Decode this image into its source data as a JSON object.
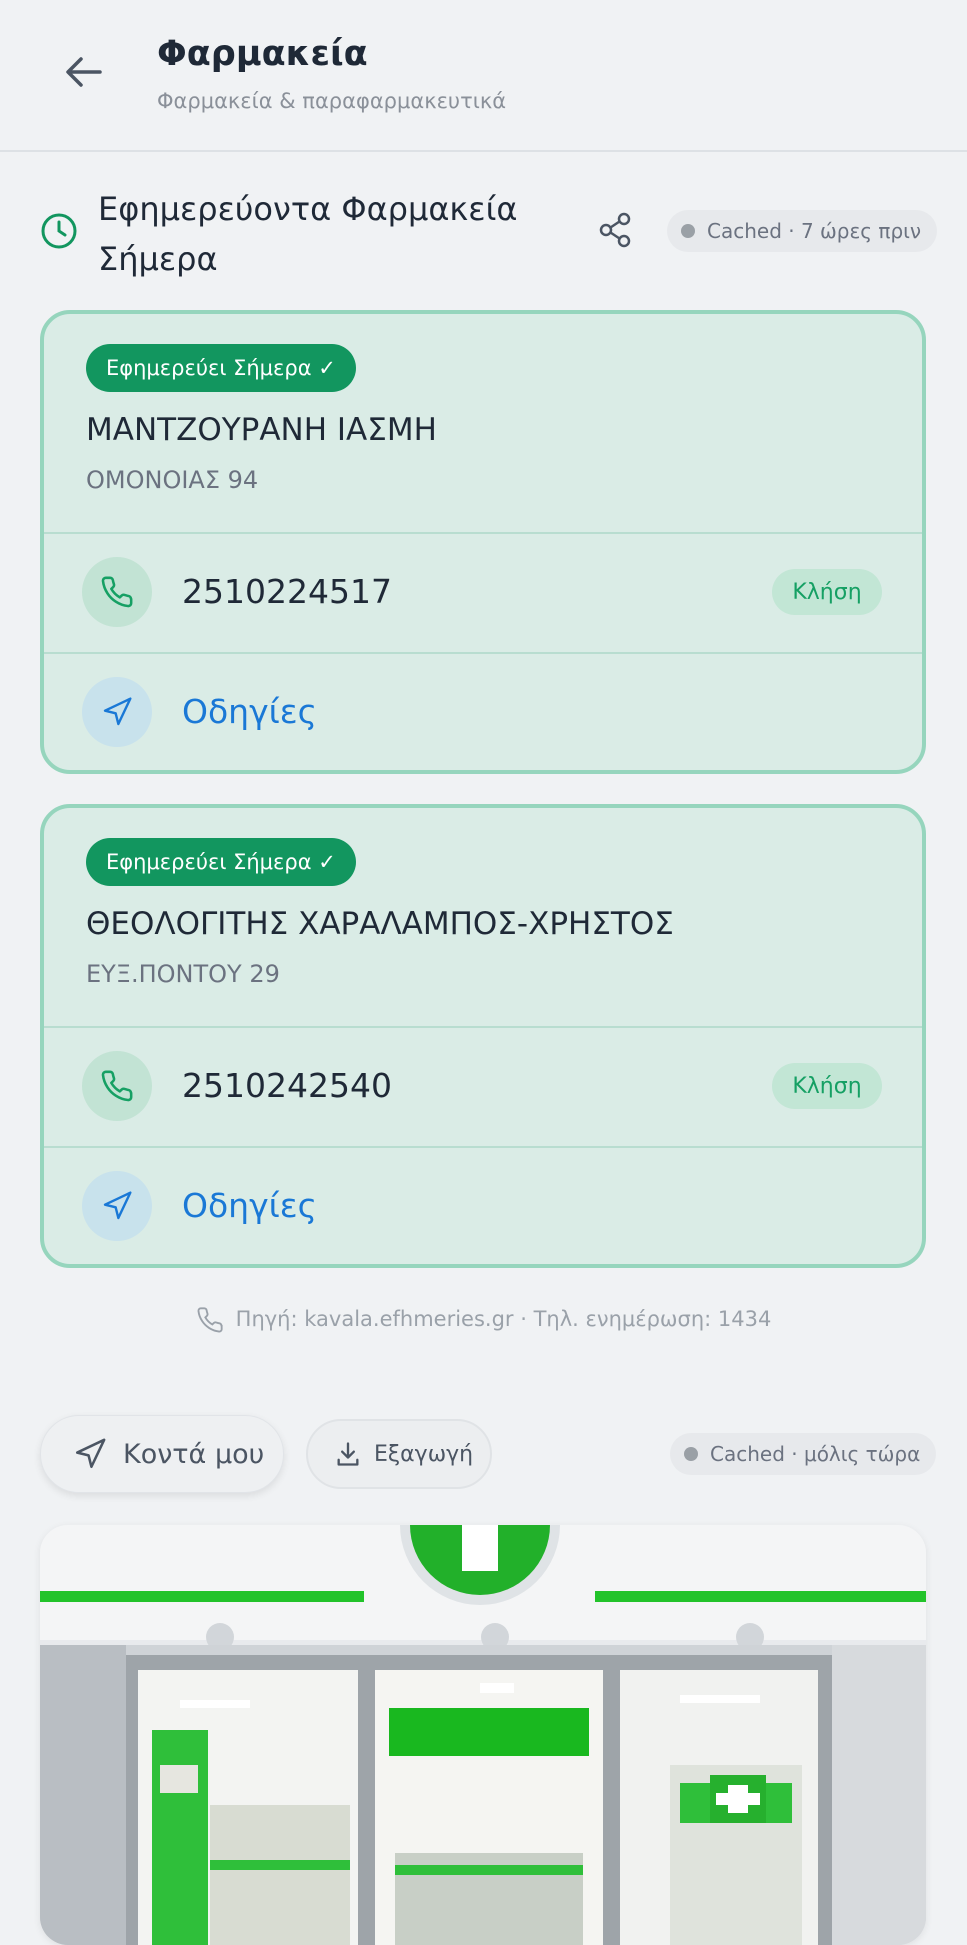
{
  "header": {
    "title": "Φαρμακεία",
    "subtitle": "Φαρμακεία & παραφαρμακευτικά"
  },
  "section": {
    "title": "Εφημερεύοντα Φαρμακεία Σήμερα",
    "cache_status": "Cached · 7 ώρες πριν"
  },
  "pharmacies": [
    {
      "badge": "Εφημερεύει Σήμερα ✓",
      "name": "ΜΑΝΤΖΟΥΡΑΝΗ ΙΑΣΜΗ",
      "address": "ΟΜΟΝΟΙΑΣ 94",
      "phone": "2510224517",
      "call_label": "Κλήση",
      "directions_label": "Οδηγίες"
    },
    {
      "badge": "Εφημερεύει Σήμερα ✓",
      "name": "ΘΕΟΛΟΓΙΤΗΣ ΧΑΡΑΛΑΜΠΟΣ-ΧΡΗΣΤΟΣ",
      "address": "ΕΥΞ.ΠΟΝΤΟΥ 29",
      "phone": "2510242540",
      "call_label": "Κλήση",
      "directions_label": "Οδηγίες"
    }
  ],
  "source_line": "Πηγή: kavala.efhmeries.gr · Τηλ. ενημέρωση: 1434",
  "actions": {
    "near_me": "Κοντά μου",
    "export": "Εξαγωγή",
    "cache_status": "Cached · μόλις τώρα"
  },
  "colors": {
    "accent_green": "#12965f",
    "card_bg": "#daece6",
    "card_border": "#96d5bd",
    "link_blue": "#1a78d6",
    "pharmacy_green": "#22c32a"
  }
}
